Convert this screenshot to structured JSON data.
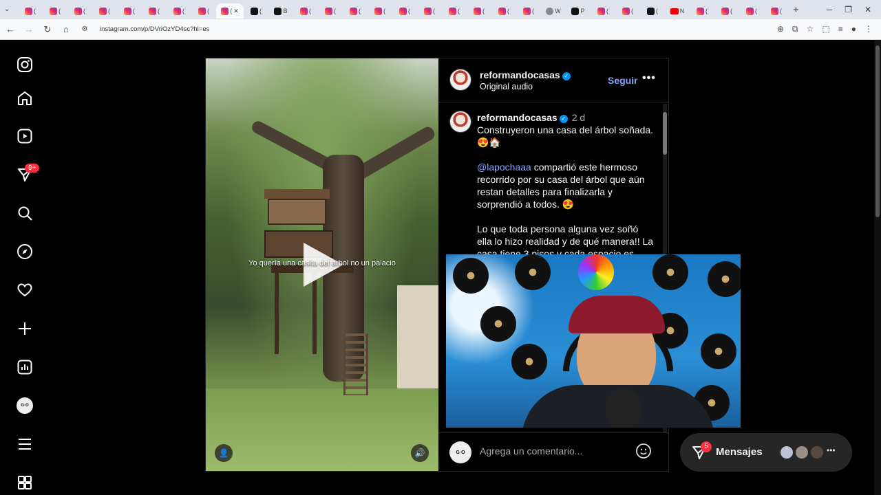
{
  "browser": {
    "url": "instagram.com/p/DVriOzYD4sc?hl=es",
    "tabs": [
      {
        "icon": "instagram",
        "label": "("
      },
      {
        "icon": "instagram",
        "label": "("
      },
      {
        "icon": "instagram",
        "label": "("
      },
      {
        "icon": "instagram",
        "label": "("
      },
      {
        "icon": "instagram",
        "label": "("
      },
      {
        "icon": "instagram",
        "label": "("
      },
      {
        "icon": "instagram",
        "label": "("
      },
      {
        "icon": "instagram",
        "label": "("
      },
      {
        "icon": "instagram",
        "label": "(",
        "active": true
      },
      {
        "icon": "tiktok",
        "label": "("
      },
      {
        "icon": "tiktok",
        "label": "B"
      },
      {
        "icon": "instagram",
        "label": "("
      },
      {
        "icon": "instagram",
        "label": "("
      },
      {
        "icon": "instagram",
        "label": "("
      },
      {
        "icon": "instagram",
        "label": "("
      },
      {
        "icon": "instagram",
        "label": "("
      },
      {
        "icon": "instagram",
        "label": "("
      },
      {
        "icon": "instagram",
        "label": "("
      },
      {
        "icon": "instagram",
        "label": "("
      },
      {
        "icon": "instagram",
        "label": "("
      },
      {
        "icon": "instagram",
        "label": "("
      },
      {
        "icon": "web",
        "label": "W"
      },
      {
        "icon": "tiktok",
        "label": "P"
      },
      {
        "icon": "instagram",
        "label": "("
      },
      {
        "icon": "instagram",
        "label": "("
      },
      {
        "icon": "tiktok",
        "label": "("
      },
      {
        "icon": "youtube",
        "label": "N"
      },
      {
        "icon": "instagram",
        "label": "("
      },
      {
        "icon": "instagram",
        "label": "("
      },
      {
        "icon": "instagram",
        "label": "("
      },
      {
        "icon": "instagram",
        "label": "("
      }
    ]
  },
  "sidebar": {
    "notifications_badge": "9+",
    "icons": [
      "instagram-logo-icon",
      "home-icon",
      "reels-icon",
      "messages-icon",
      "search-icon",
      "explore-icon",
      "heart-icon",
      "create-icon",
      "dashboard-icon",
      "profile-avatar",
      "menu-icon",
      "more-icon"
    ]
  },
  "post": {
    "video_caption": "Yo quería una casita del árbol no un palacio",
    "header": {
      "username": "reformandocasas",
      "subtitle": "Original audio",
      "follow_label": "Seguir",
      "more_label": "•••"
    },
    "caption": {
      "username": "reformandocasas",
      "time": "2 d",
      "line1": "Construyeron una casa del árbol soñada. 😍🏠",
      "mention": "@lapochaaa",
      "para2": " compartió este hermoso recorrido por su casa del árbol que aún restan detalles para finalizarla y sorprendió a todos. 😍",
      "para3": "Lo que toda persona alguna vez soñó ella lo hizo realidad y de qué manera!! La casa tiene 3 pisos y cada espacio es..."
    },
    "add_comment_placeholder": "Agrega un comentario..."
  },
  "messages": {
    "label": "Mensajes",
    "badge": "5",
    "more": "•••"
  },
  "colors": {
    "accent_link": "#85a1ff",
    "badge": "#ff3040",
    "verified": "#0095f6"
  }
}
